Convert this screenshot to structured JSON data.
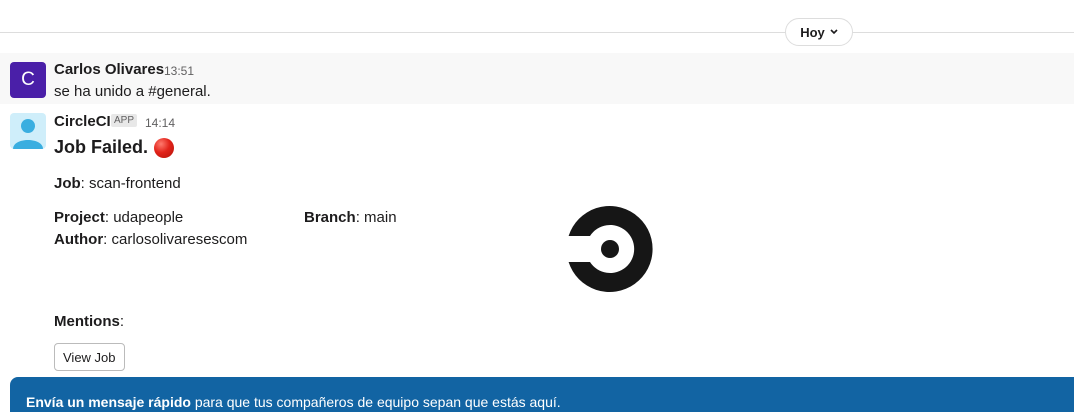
{
  "date_divider": {
    "label": "Hoy"
  },
  "messages": [
    {
      "sender": "Carlos Olivares",
      "avatar_letter": "C",
      "time": "13:51",
      "text": "se ha unido a #general."
    },
    {
      "sender": "CircleCI",
      "badge": "APP",
      "time": "14:14",
      "title": "Job Failed.",
      "status_icon": "red-circle-emoji",
      "fields": {
        "job_label": "Job",
        "job_value": ": scan-frontend",
        "project_label": "Project",
        "project_value": ": udapeople",
        "branch_label": "Branch",
        "branch_value": ": main",
        "author_label": "Author",
        "author_value": ": carlosolivaresescom",
        "mentions_label": "Mentions",
        "mentions_value": ":"
      },
      "button_label": "View Job",
      "logo": "circleci-logo"
    }
  ],
  "banner": {
    "bold_text": "Envía un mensaje rápido",
    "text": " para que tus compañeros de equipo sepan que estás aquí."
  },
  "colors": {
    "avatar_purple": "#4a1fa8",
    "banner_blue": "#1264a3",
    "status_red": "#e2231a"
  }
}
